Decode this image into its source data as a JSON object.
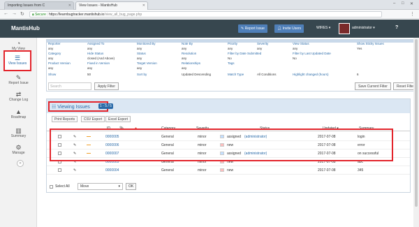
{
  "browser": {
    "tabs": [
      {
        "label": "Importing Issues from C",
        "active": false
      },
      {
        "label": "View Issues - MantisHub",
        "active": true
      }
    ],
    "url_secure": "Secure",
    "url_host": "https://learnbugtracker.mantishub.io",
    "url_path": "/view_all_bug_page.php"
  },
  "header": {
    "brand": "MantisHub",
    "report_issue": "Report Issue",
    "invite_users": "Invite Users",
    "project": "WIRES",
    "username": "administrator",
    "help": "?"
  },
  "sidebar": {
    "items": [
      {
        "label": "My View",
        "icon": "dashboard-icon"
      },
      {
        "label": "View Issues",
        "icon": "list-icon"
      },
      {
        "label": "Report Issue",
        "icon": "pencil-icon"
      },
      {
        "label": "Change Log",
        "icon": "retweet-icon"
      },
      {
        "label": "Roadmap",
        "icon": "road-icon"
      },
      {
        "label": "Summary",
        "icon": "bar-chart-icon"
      },
      {
        "label": "Manage",
        "icon": "gears-icon"
      }
    ]
  },
  "filters": {
    "row1_labels": [
      "Reporter",
      "Assigned To",
      "Monitored By",
      "Note By",
      "Priority",
      "Severity",
      "View Status",
      "Show Sticky Issues"
    ],
    "row1_values": [
      "any",
      "any",
      "any",
      "any",
      "any",
      "any",
      "any",
      "Yes"
    ],
    "row2_labels": [
      "Category",
      "Hide Status",
      "Status",
      "Resolution",
      "Filter by Date Submitted",
      "",
      "Filter by Last Updated Date",
      ""
    ],
    "row2_values": [
      "any",
      "closed (And Above)",
      "any",
      "any",
      "No",
      "",
      "No",
      ""
    ],
    "row3_labels": [
      "Product Version",
      "Fixed in Version",
      "Target Version",
      "Relationships",
      "Tags",
      "",
      "",
      ""
    ],
    "row3_values": [
      "any",
      "any",
      "any",
      "any",
      "",
      "",
      "",
      ""
    ],
    "row4_labels": [
      "Show",
      "50",
      "Sort by",
      "Updated Descending",
      "Match Type",
      "All Conditions",
      "Highlight changed (hours)",
      "6"
    ],
    "search_placeholder": "Search",
    "apply_filter": "Apply Filter",
    "save_filter": "Save Current Filter",
    "reset_filter": "Reset Filter"
  },
  "issues": {
    "title": "Viewing Issues",
    "count": "1 - 5 / 5",
    "print_reports": "Print Reports",
    "csv_export": "CSV Export",
    "excel_export": "Excel Export",
    "columns": {
      "id": "ID",
      "category": "Category",
      "severity": "Severity",
      "status": "Status",
      "updated": "Updated ▾",
      "summary": "Summary"
    },
    "rows": [
      {
        "id": "0000005",
        "category": "General",
        "severity": "minor",
        "status": "assigned",
        "handler": "(administrator)",
        "updated": "2017-07-08",
        "summary": "login",
        "color": "#c2dfff"
      },
      {
        "id": "0000006",
        "category": "General",
        "severity": "minor",
        "status": "new",
        "handler": "",
        "updated": "2017-07-08",
        "summary": "error",
        "color": "#fcbdbd"
      },
      {
        "id": "0000007",
        "category": "General",
        "severity": "minor",
        "status": "assigned",
        "handler": "(administrator)",
        "updated": "2017-07-08",
        "summary": "on successful",
        "color": "#c2dfff"
      },
      {
        "id": "0000003",
        "category": "General",
        "severity": "minor",
        "status": "new",
        "handler": "",
        "updated": "2017-07-08",
        "summary": "abc",
        "color": "#fcbdbd"
      },
      {
        "id": "0000004",
        "category": "General",
        "severity": "minor",
        "status": "new",
        "handler": "",
        "updated": "2017-07-08",
        "summary": "345",
        "color": "#fcbdbd"
      }
    ],
    "select_all": "Select All",
    "move": "Move",
    "ok": "OK"
  }
}
